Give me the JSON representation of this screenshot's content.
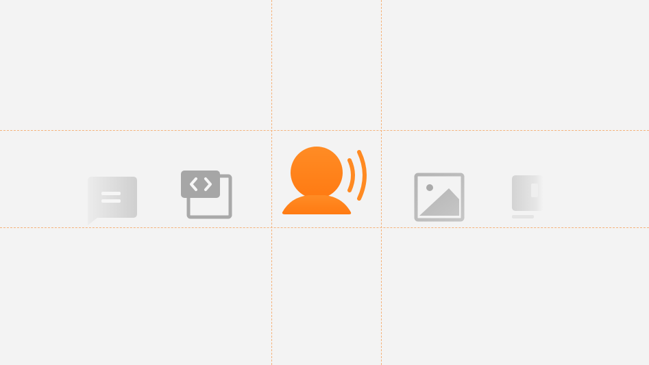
{
  "theme": {
    "background": "#f3f3f3",
    "guide_color": "#f4b27a",
    "accent": "#ff7f1a",
    "muted": "#a7a7a7"
  },
  "icons": [
    {
      "name": "chat-icon",
      "state": "faded"
    },
    {
      "name": "code-window-icon",
      "state": "muted"
    },
    {
      "name": "voice-speaker-icon",
      "state": "active"
    },
    {
      "name": "image-icon",
      "state": "muted"
    },
    {
      "name": "document-icon",
      "state": "faded"
    }
  ]
}
